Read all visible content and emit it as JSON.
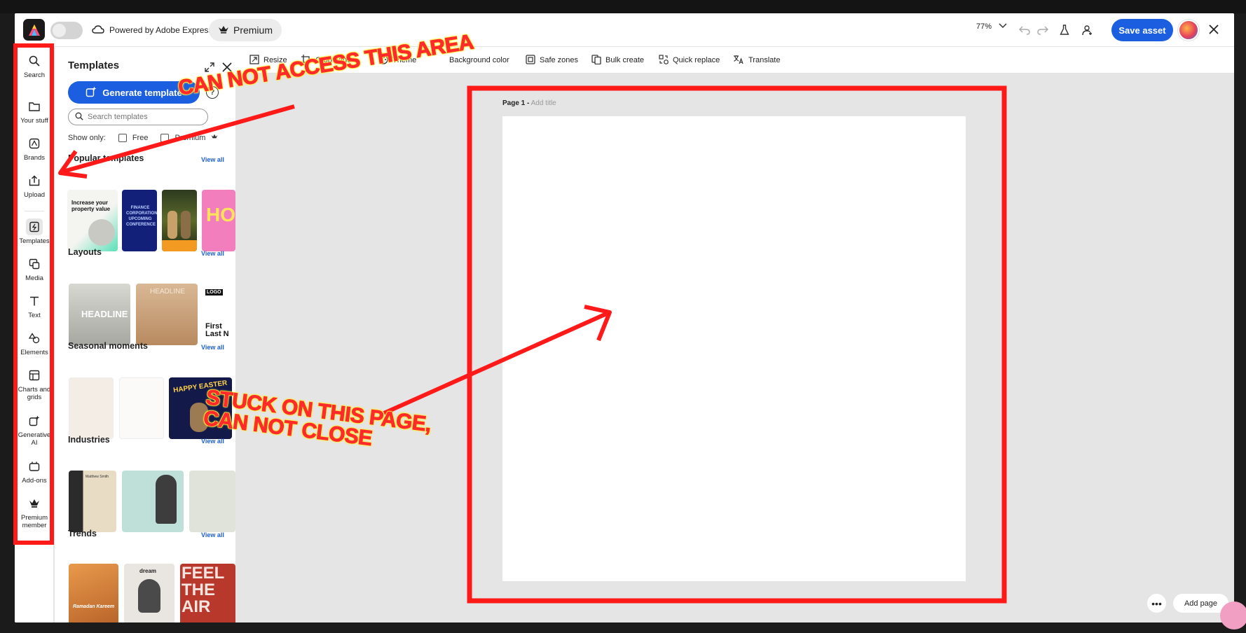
{
  "header": {
    "powered_by": "Powered by Adobe Express",
    "premium_label": "Premium",
    "zoom": "77%",
    "save_label": "Save asset"
  },
  "rail": {
    "items": [
      {
        "label": "Search",
        "icon": "search-icon"
      },
      {
        "label": "Your stuff",
        "icon": "folder-icon"
      },
      {
        "label": "Brands",
        "icon": "brand-icon"
      },
      {
        "label": "Upload",
        "icon": "upload-icon"
      },
      {
        "label": "Templates",
        "icon": "templates-icon"
      },
      {
        "label": "Media",
        "icon": "media-icon"
      },
      {
        "label": "Text",
        "icon": "text-icon"
      },
      {
        "label": "Elements",
        "icon": "elements-icon"
      },
      {
        "label": "Charts and grids",
        "icon": "charts-icon"
      },
      {
        "label": "Generative AI",
        "icon": "generative-ai-icon"
      },
      {
        "label": "Add-ons",
        "icon": "addons-icon"
      },
      {
        "label": "Premium member",
        "icon": "crown-icon"
      }
    ]
  },
  "panel": {
    "title": "Templates",
    "generate_label": "Generate template",
    "search_placeholder": "Search templates",
    "show_only": "Show only:",
    "filter_free": "Free",
    "filter_premium": "Premium",
    "view_all": "View all",
    "sections": [
      {
        "title": "Popular templates"
      },
      {
        "title": "Layouts"
      },
      {
        "title": "Seasonal moments"
      },
      {
        "title": "Industries"
      },
      {
        "title": "Trends"
      }
    ],
    "thumb_text": {
      "property": "Increase your property value",
      "finance": "FINANCE CORPORATION'S UPCOMING CONFERENCE",
      "hot": "HO",
      "headline": "HEADLINE",
      "logo": "LOGO",
      "first_last": "First Last N",
      "easter": "HAPPY EASTER",
      "resume_name": "Matthew Smith",
      "ramadan": "Ramadan Kareem",
      "feel": "FEEL THE AIR",
      "dream": "dream"
    }
  },
  "toolbar": {
    "tools": [
      "Resize",
      "Crop page",
      "Theme",
      "Background color",
      "Safe zones",
      "Bulk create",
      "Quick replace",
      "Translate"
    ]
  },
  "canvas": {
    "page_label": "Page 1 -",
    "page_title_placeholder": "Add title",
    "add_page": "Add page",
    "more": "•••"
  },
  "annotations": {
    "top": "CAN NOT ACCESS THIS AREA",
    "bottom_line1": "STUCK ON THIS PAGE,",
    "bottom_line2": "CAN NOT CLOSE",
    "color": "#ff1a1a"
  }
}
